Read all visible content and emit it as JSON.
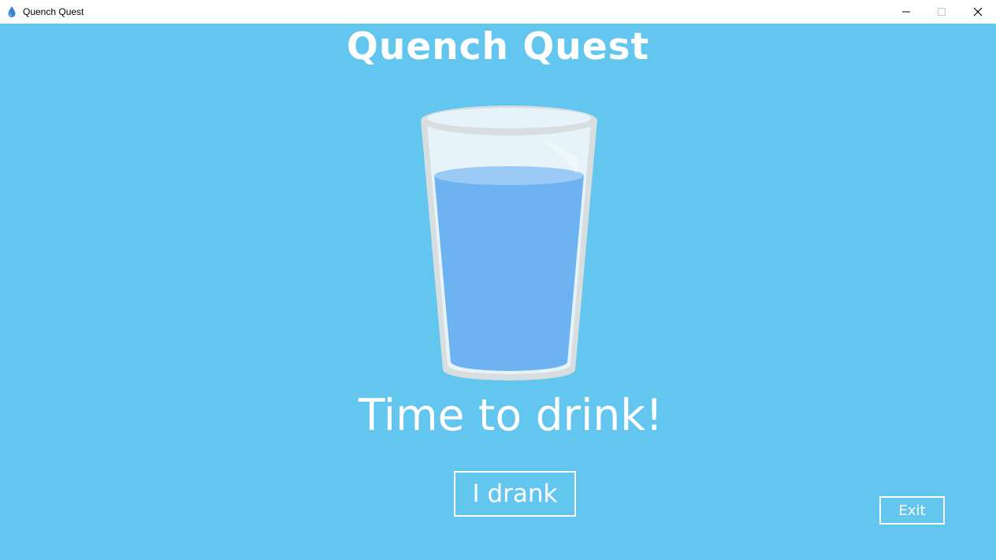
{
  "window": {
    "title": "Quench Quest",
    "icon": "water-drop-icon",
    "controls": [
      "minimize-icon",
      "maximize-icon",
      "close-icon"
    ]
  },
  "app": {
    "heading": "Quench Quest",
    "message": "Time to drink!",
    "illustration": "water-glass",
    "drank_button_label": "I drank",
    "exit_button_label": "Exit"
  },
  "colors": {
    "background": "#62c6ef",
    "water": "#6db3f2",
    "water_surface": "#9ccaf6",
    "glass": "#e8f4f8",
    "glass_rim": "#d8dde0",
    "text": "#ffffff"
  }
}
